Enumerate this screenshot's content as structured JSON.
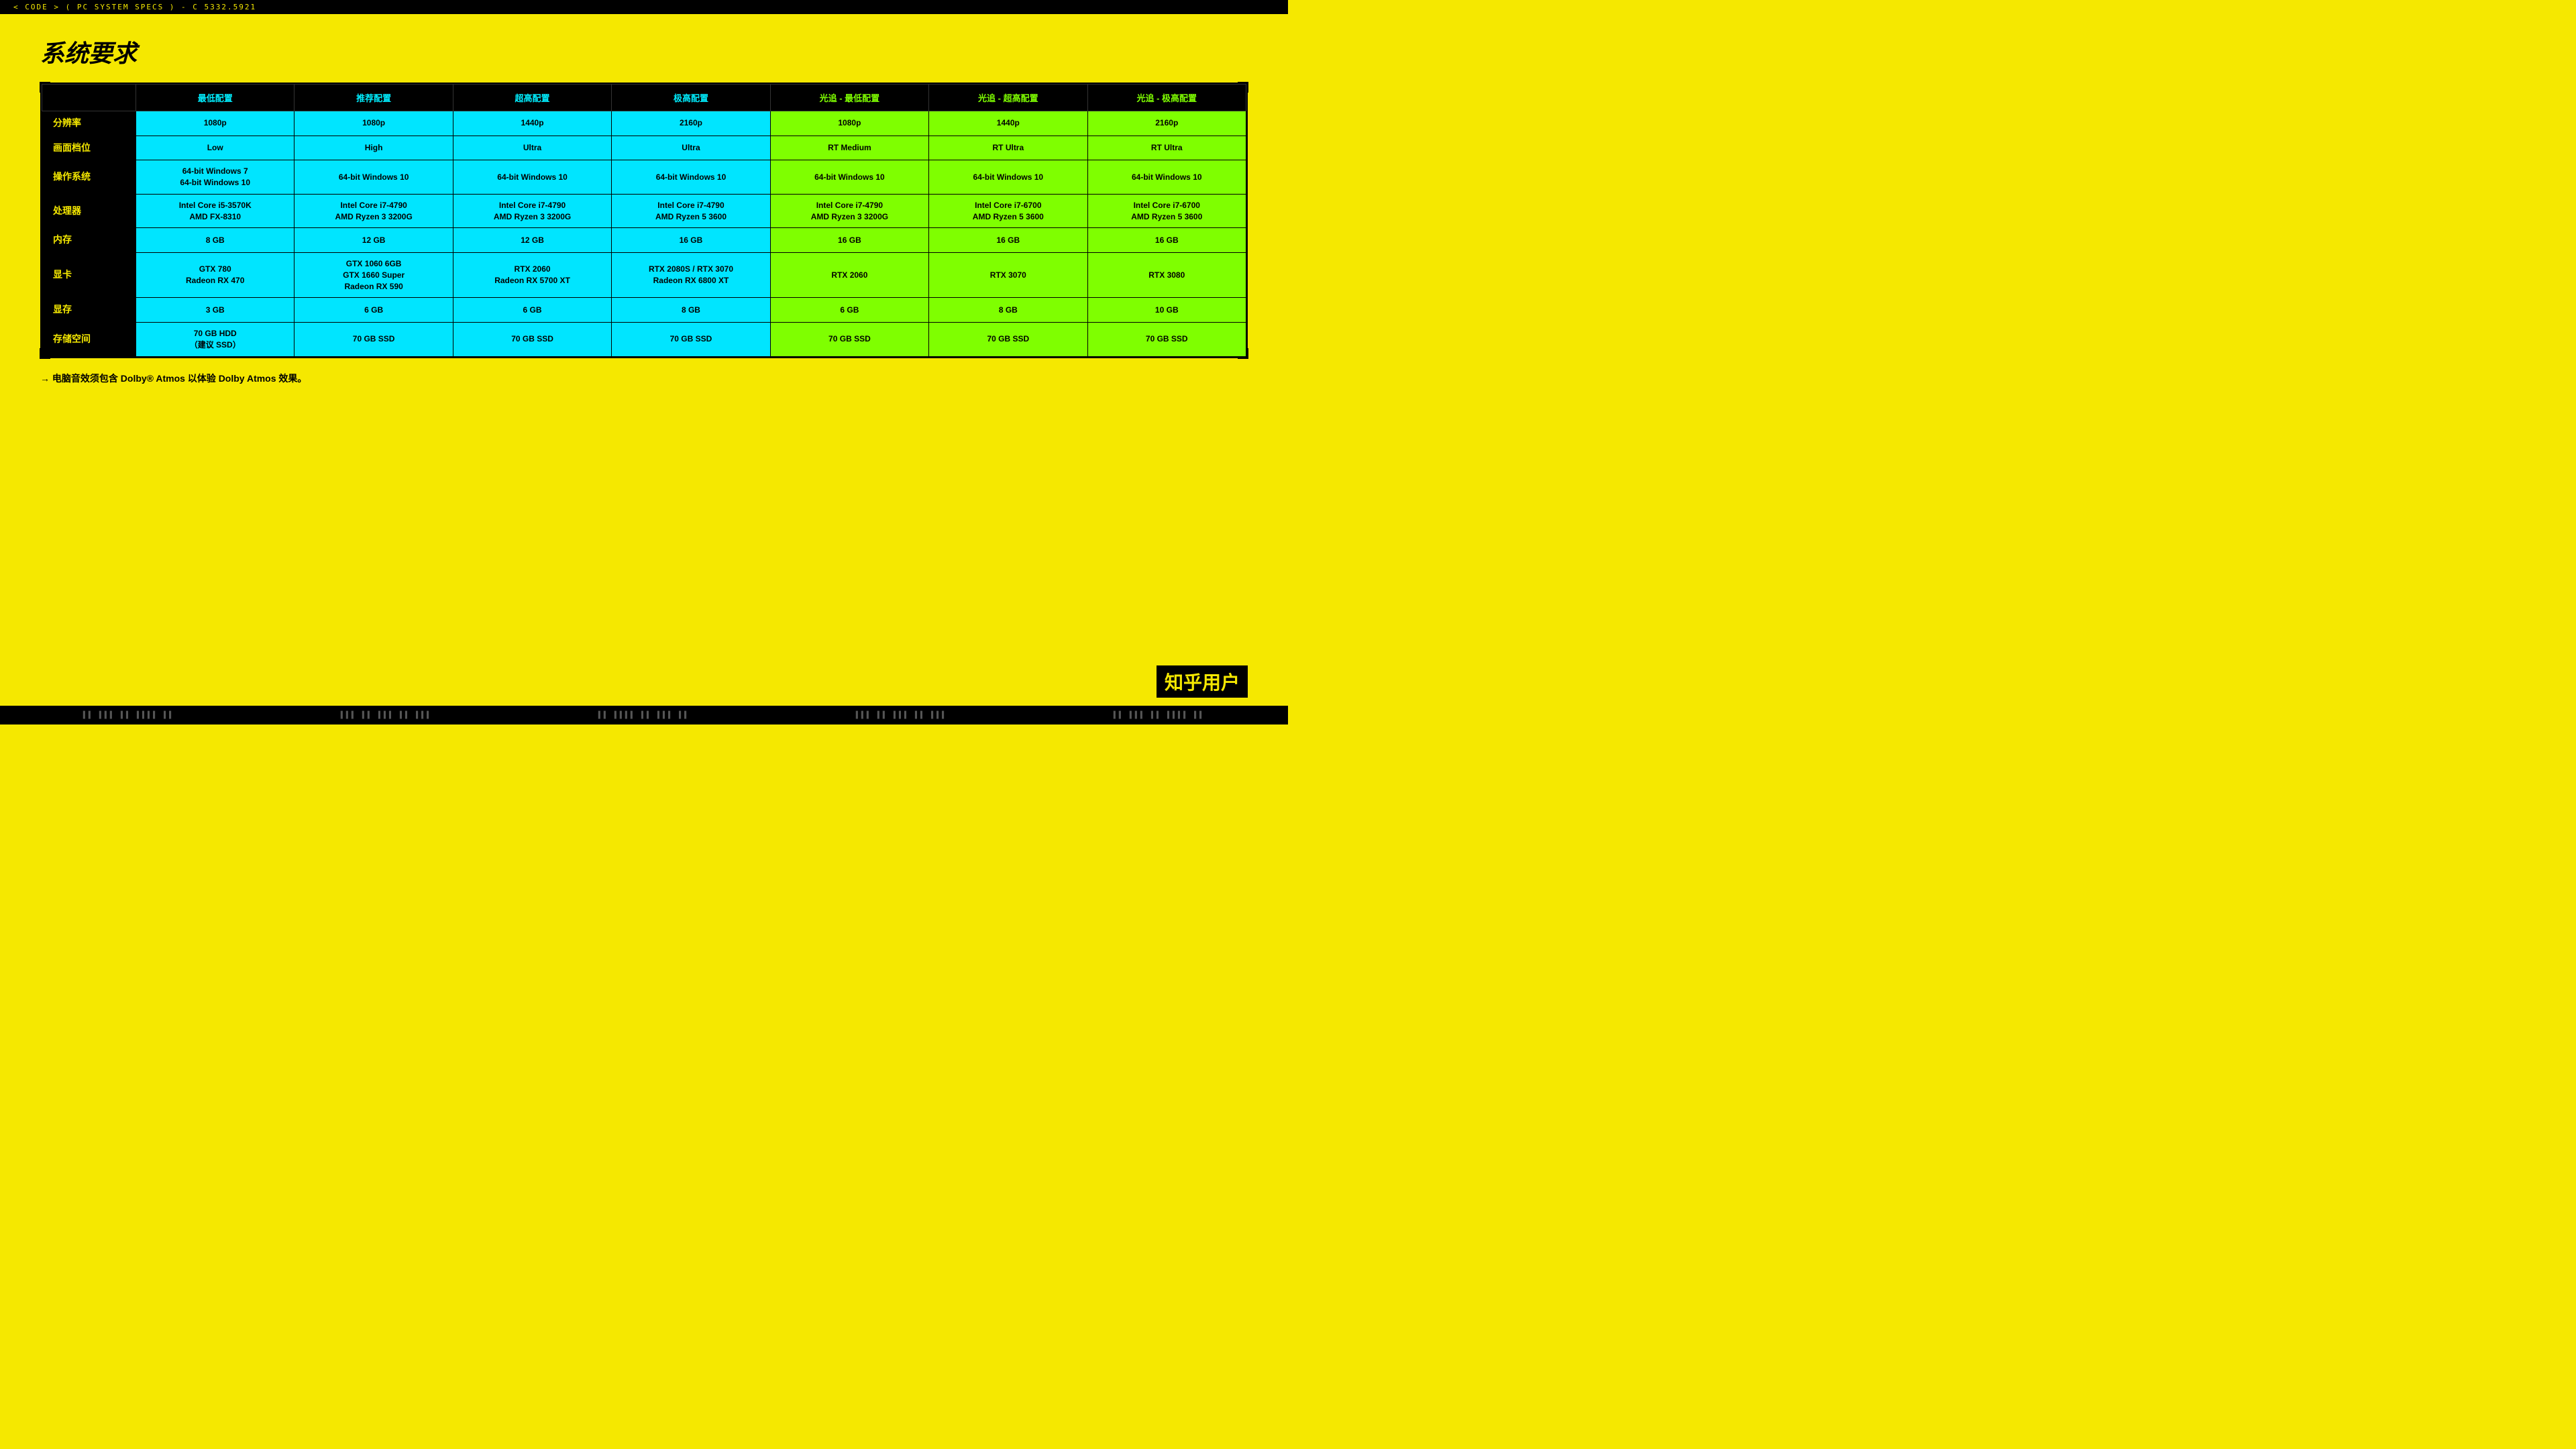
{
  "topbar": {
    "text": "< CODE > ( PC SYSTEM SPECS ) - C 5332.5921"
  },
  "page_title": "系统要求",
  "table": {
    "headers": [
      {
        "label": "",
        "type": "empty"
      },
      {
        "label": "最低配置",
        "type": "cyan"
      },
      {
        "label": "推荐配置",
        "type": "cyan"
      },
      {
        "label": "超高配置",
        "type": "cyan"
      },
      {
        "label": "极高配置",
        "type": "cyan"
      },
      {
        "label": "光追 - 最低配置",
        "type": "green"
      },
      {
        "label": "光追 - 超高配置",
        "type": "green"
      },
      {
        "label": "光追 - 极高配置",
        "type": "green"
      }
    ],
    "rows": [
      {
        "label": "分辨率",
        "cells": [
          {
            "value": "1080p",
            "type": "cyan"
          },
          {
            "value": "1080p",
            "type": "cyan"
          },
          {
            "value": "1440p",
            "type": "cyan"
          },
          {
            "value": "2160p",
            "type": "cyan"
          },
          {
            "value": "1080p",
            "type": "green"
          },
          {
            "value": "1440p",
            "type": "green"
          },
          {
            "value": "2160p",
            "type": "green"
          }
        ]
      },
      {
        "label": "画面档位",
        "cells": [
          {
            "value": "Low",
            "type": "cyan"
          },
          {
            "value": "High",
            "type": "cyan"
          },
          {
            "value": "Ultra",
            "type": "cyan"
          },
          {
            "value": "Ultra",
            "type": "cyan"
          },
          {
            "value": "RT Medium",
            "type": "green"
          },
          {
            "value": "RT Ultra",
            "type": "green"
          },
          {
            "value": "RT Ultra",
            "type": "green"
          }
        ]
      },
      {
        "label": "操作系统",
        "cells": [
          {
            "value": "64-bit Windows 7\n64-bit Windows 10",
            "type": "cyan"
          },
          {
            "value": "64-bit Windows 10",
            "type": "cyan"
          },
          {
            "value": "64-bit Windows 10",
            "type": "cyan"
          },
          {
            "value": "64-bit Windows 10",
            "type": "cyan"
          },
          {
            "value": "64-bit Windows 10",
            "type": "green"
          },
          {
            "value": "64-bit Windows 10",
            "type": "green"
          },
          {
            "value": "64-bit Windows 10",
            "type": "green"
          }
        ]
      },
      {
        "label": "处理器",
        "cells": [
          {
            "value": "Intel Core i5-3570K\nAMD FX-8310",
            "type": "cyan"
          },
          {
            "value": "Intel Core i7-4790\nAMD Ryzen 3 3200G",
            "type": "cyan"
          },
          {
            "value": "Intel Core i7-4790\nAMD Ryzen 3 3200G",
            "type": "cyan"
          },
          {
            "value": "Intel Core i7-4790\nAMD Ryzen 5 3600",
            "type": "cyan"
          },
          {
            "value": "Intel Core i7-4790\nAMD Ryzen 3 3200G",
            "type": "green"
          },
          {
            "value": "Intel Core i7-6700\nAMD Ryzen 5 3600",
            "type": "green"
          },
          {
            "value": "Intel Core i7-6700\nAMD Ryzen 5 3600",
            "type": "green"
          }
        ]
      },
      {
        "label": "内存",
        "cells": [
          {
            "value": "8 GB",
            "type": "cyan"
          },
          {
            "value": "12 GB",
            "type": "cyan"
          },
          {
            "value": "12 GB",
            "type": "cyan"
          },
          {
            "value": "16 GB",
            "type": "cyan"
          },
          {
            "value": "16 GB",
            "type": "green"
          },
          {
            "value": "16 GB",
            "type": "green"
          },
          {
            "value": "16 GB",
            "type": "green"
          }
        ]
      },
      {
        "label": "显卡",
        "cells": [
          {
            "value": "GTX 780\nRadeon RX 470",
            "type": "cyan"
          },
          {
            "value": "GTX 1060 6GB\nGTX 1660 Super\nRadeon RX 590",
            "type": "cyan"
          },
          {
            "value": "RTX 2060\nRadeon RX 5700 XT",
            "type": "cyan"
          },
          {
            "value": "RTX 2080S / RTX 3070\nRadeon RX 6800 XT",
            "type": "cyan"
          },
          {
            "value": "RTX 2060",
            "type": "green"
          },
          {
            "value": "RTX 3070",
            "type": "green"
          },
          {
            "value": "RTX 3080",
            "type": "green"
          }
        ]
      },
      {
        "label": "显存",
        "cells": [
          {
            "value": "3 GB",
            "type": "cyan"
          },
          {
            "value": "6 GB",
            "type": "cyan"
          },
          {
            "value": "6 GB",
            "type": "cyan"
          },
          {
            "value": "8 GB",
            "type": "cyan"
          },
          {
            "value": "6 GB",
            "type": "green"
          },
          {
            "value": "8 GB",
            "type": "green"
          },
          {
            "value": "10 GB",
            "type": "green"
          }
        ]
      },
      {
        "label": "存储空间",
        "cells": [
          {
            "value": "70 GB HDD\n（建议 SSD）",
            "type": "cyan"
          },
          {
            "value": "70 GB SSD",
            "type": "cyan"
          },
          {
            "value": "70 GB SSD",
            "type": "cyan"
          },
          {
            "value": "70 GB SSD",
            "type": "cyan"
          },
          {
            "value": "70 GB SSD",
            "type": "green"
          },
          {
            "value": "70 GB SSD",
            "type": "green"
          },
          {
            "value": "70 GB SSD",
            "type": "green"
          }
        ]
      }
    ]
  },
  "footer_note": "电脑音效须包含 Dolby® Atmos 以体验 Dolby Atmos 效果。",
  "watermark": "知乎用户"
}
